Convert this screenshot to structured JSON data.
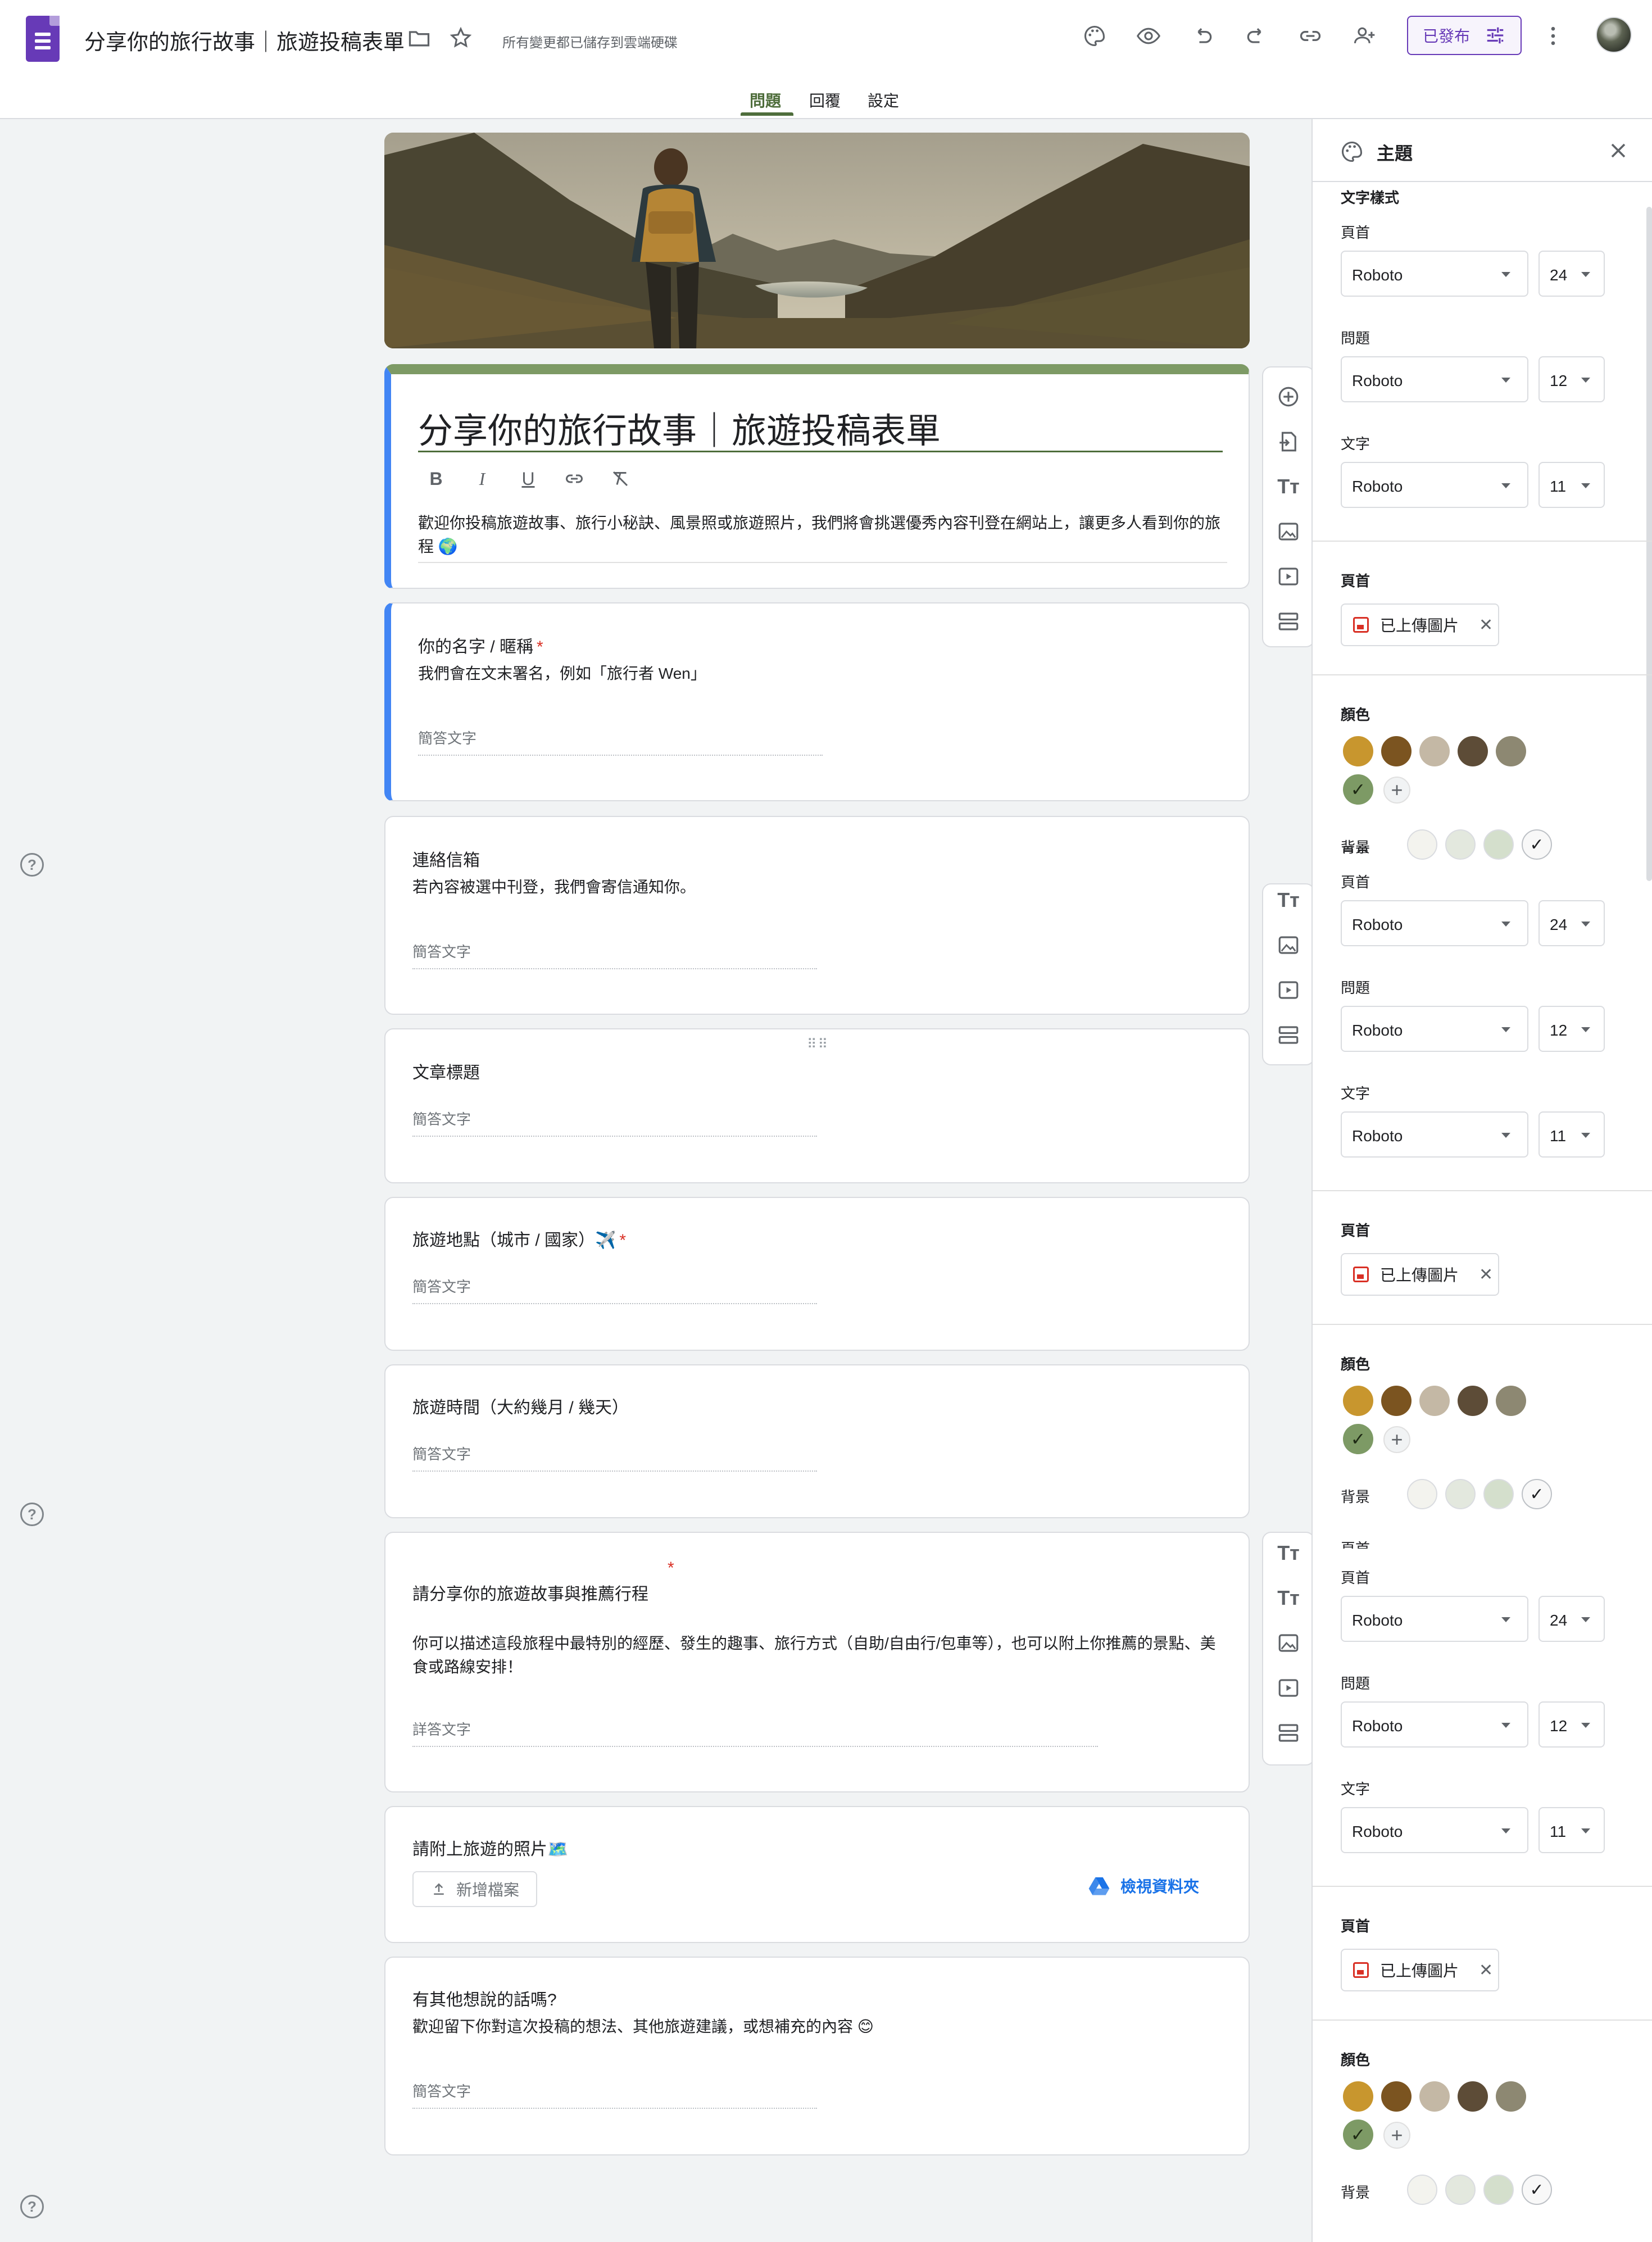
{
  "app": {
    "doc_title": "分享你的旅行故事｜旅遊投稿表單",
    "saved_status": "所有變更都已儲存到雲端硬碟",
    "publish_label": "已發布"
  },
  "tabs": [
    {
      "label": "問題",
      "active": true
    },
    {
      "label": "回覆",
      "active": false
    },
    {
      "label": "設定",
      "active": false
    }
  ],
  "form": {
    "title": "分享你的旅行故事｜旅遊投稿表單",
    "description": "歡迎你投稿旅遊故事、旅行小秘訣、風景照或旅遊照片，我們將會挑選優秀內容刊登在網站上，讓更多人看到你的旅程 🌍"
  },
  "questions": [
    {
      "title": "你的名字 / 暱稱",
      "required": true,
      "description": "我們會在文末署名，例如「旅行者 Wen」",
      "placeholder": "簡答文字"
    },
    {
      "title": "連絡信箱",
      "required": false,
      "description": "若內容被選中刊登，我們會寄信通知你。",
      "placeholder": "簡答文字"
    },
    {
      "title": "文章標題",
      "required": false,
      "description": "",
      "placeholder": "簡答文字"
    },
    {
      "title": "旅遊地點（城市 / 國家）✈️",
      "required": true,
      "description": "",
      "placeholder": "簡答文字"
    },
    {
      "title": "旅遊時間（大約幾月 / 幾天）",
      "required": false,
      "description": "",
      "placeholder": "簡答文字"
    },
    {
      "title": "請分享你的旅遊故事與推薦行程",
      "required": true,
      "description": "你可以描述這段旅程中最特別的經歷、發生的趣事、旅行方式（自助/自由行/包車等），也可以附上你推薦的景點、美食或路線安排！",
      "placeholder": "詳答文字"
    },
    {
      "title": "請附上旅遊的照片🗺️",
      "required": false,
      "add_file_label": "新增檔案",
      "drive_link_label": "檢視資料夾"
    },
    {
      "title": "有其他想說的話嗎?",
      "required": false,
      "description": "歡迎留下你對這次投稿的想法、其他旅遊建議，或想補充的內容 😊",
      "placeholder": "簡答文字"
    }
  ],
  "theme_panel": {
    "title": "主題",
    "text_style_label": "文字樣式",
    "header_label": "頁首",
    "question_label": "問題",
    "text_label": "文字",
    "header_font": "Roboto",
    "header_size": "24",
    "question_font": "Roboto",
    "question_size": "12",
    "text_font": "Roboto",
    "text_size": "11",
    "header_image_label": "頁首",
    "uploaded_image_label": "已上傳圖片",
    "color_label": "顏色",
    "background_label": "背景",
    "theme_colors": [
      "#c8962e",
      "#7b5420",
      "#c4b8a5",
      "#5d4c37",
      "#8d8872",
      "#7d9a65"
    ],
    "selected_theme_color": "#7d9a65",
    "background_colors": [
      "#f3f3ee",
      "#e3e8de",
      "#d4dfcc",
      "#f8f8f8"
    ]
  }
}
